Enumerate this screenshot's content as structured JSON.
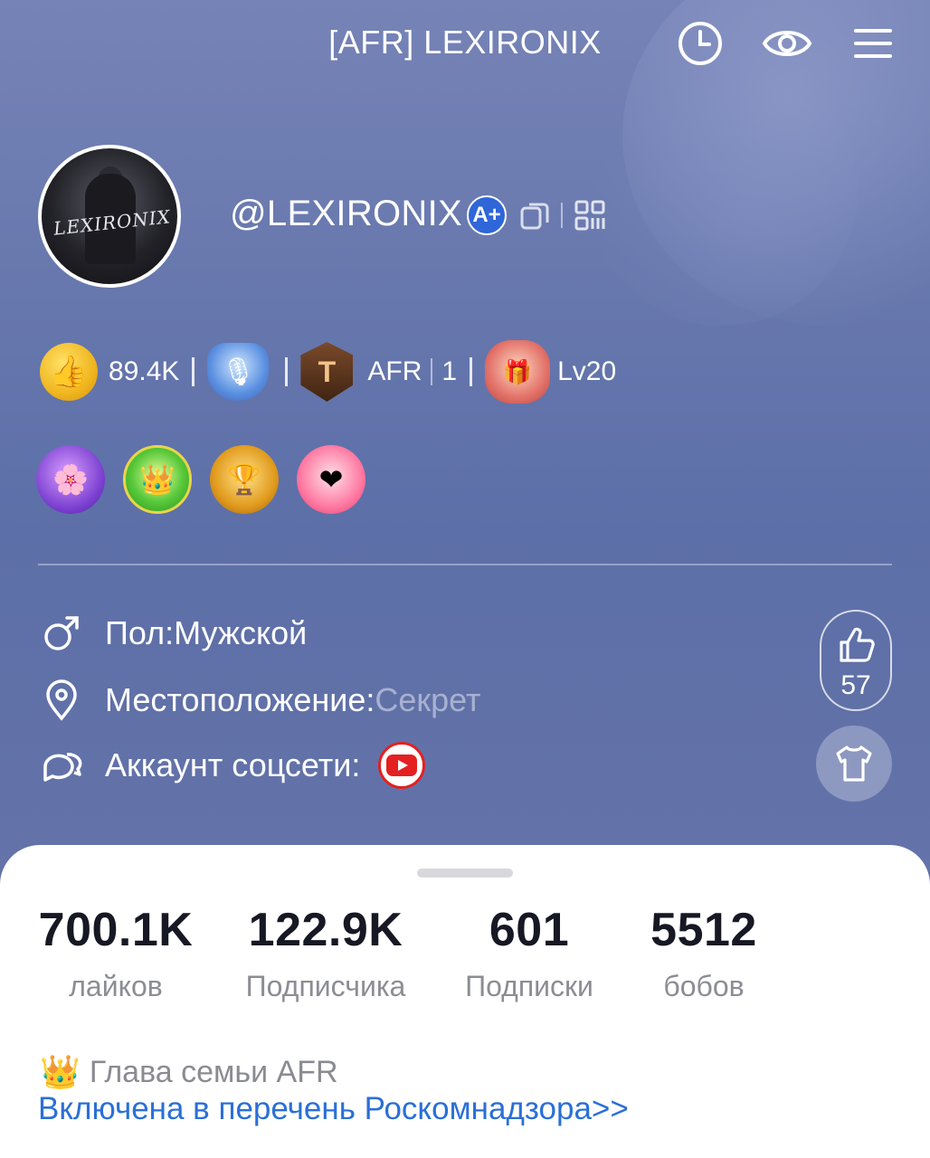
{
  "header": {
    "title": "[AFR] LEXIRONIX",
    "icons": [
      "history-icon",
      "eye-icon",
      "menu-icon"
    ]
  },
  "profile": {
    "username": "@LEXIRONIX",
    "verified_badge": "A+",
    "avatar_text": "LEXIRONIX",
    "coins": "89.4K",
    "family_tag": "AFR",
    "family_rank": "1",
    "level": "Lv20"
  },
  "info": {
    "gender_label": "Пол:",
    "gender_value": "Мужской",
    "location_label": "Местоположение:",
    "location_value": "Секрет",
    "social_label": "Аккаунт соцсети:"
  },
  "side": {
    "likes_count": "57"
  },
  "stats": [
    {
      "value": "700.1K",
      "label": "лайков"
    },
    {
      "value": "122.9K",
      "label": "Подписчика"
    },
    {
      "value": "601",
      "label": "Подписки"
    },
    {
      "value": "5512",
      "label": "бобов"
    }
  ],
  "footer": {
    "family_text": "Глава семьи AFR",
    "link_text": "Включена в перечень Роскомнадзора>>"
  },
  "colors": {
    "hero_bg": "#6677ad",
    "link": "#2a6fd8",
    "youtube": "#e42020"
  }
}
